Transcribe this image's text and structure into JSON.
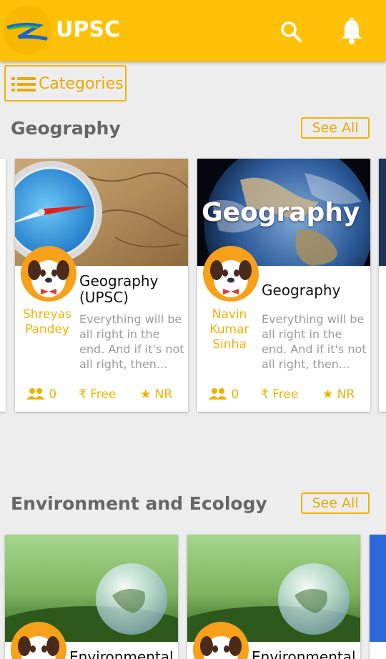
{
  "app": {
    "title": "UPSC"
  },
  "toolbar": {
    "categories_label": "Categories"
  },
  "sections": [
    {
      "title": "Geography",
      "see_all": "See All",
      "cards": [
        {
          "title": "Geography\n(UPSC)",
          "author": "Shreyas\nPandey",
          "description": "Everything will be all right in the end. And if it's not all right, then...",
          "members": "0",
          "price": "Free",
          "rating": "NR"
        },
        {
          "title": "Geography",
          "banner_text": "Geography",
          "author": "Navin\nKumar\nSinha",
          "description": "Everything will be all right in the end. And if it's not all right, then...",
          "members": "0",
          "price": "Free",
          "rating": "NR"
        }
      ]
    },
    {
      "title": "Environment and Ecology",
      "see_all": "See All",
      "cards": [
        {
          "title": "Environmental"
        },
        {
          "title": "Environmental"
        }
      ]
    }
  ],
  "icons": {
    "logo": "z-logo-icon",
    "search": "search-icon",
    "notifications": "bell-icon",
    "list": "list-icon",
    "members": "group-icon",
    "price": "rupee-icon",
    "rating": "star-icon"
  },
  "colors": {
    "accent": "#ffc107",
    "accent_text": "#e9a900",
    "card_bg": "#ffffff",
    "page_bg": "#ededed"
  }
}
